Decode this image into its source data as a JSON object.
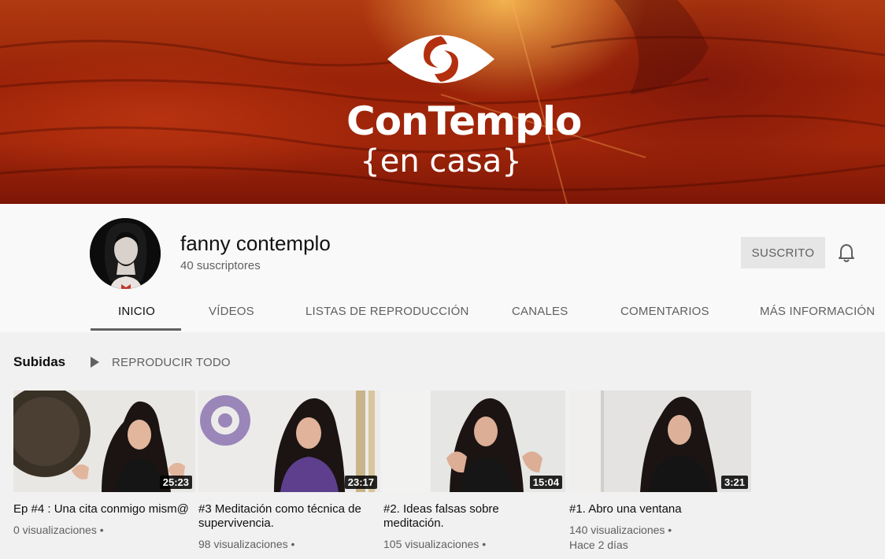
{
  "banner": {
    "brand": "ConTemplo",
    "tagline": "{en casa}",
    "icon": "eye-swirl-logo"
  },
  "channel": {
    "name": "fanny contemplo",
    "subscribers": "40 suscriptores",
    "subscribe_label": "SUSCRITO",
    "bell_icon": "bell-icon"
  },
  "tabs": [
    {
      "label": "INICIO"
    },
    {
      "label": "VÍDEOS"
    },
    {
      "label": "LISTAS DE REPRODUCCIÓN"
    },
    {
      "label": "CANALES"
    },
    {
      "label": "COMENTARIOS"
    },
    {
      "label": "MÁS INFORMACIÓN"
    }
  ],
  "active_tab": "INICIO",
  "section": {
    "title": "Subidas",
    "play_all": "REPRODUCIR TODO",
    "play_icon": "play-icon"
  },
  "videos": [
    {
      "title": "Ep #4 : Una cita conmigo mism@",
      "duration": "25:23",
      "views": "0 visualizaciones",
      "age": ""
    },
    {
      "title": "#3 Meditación como técnica de supervivencia.",
      "duration": "23:17",
      "views": "98 visualizaciones",
      "age": ""
    },
    {
      "title": "#2. Ideas falsas sobre meditación.",
      "duration": "15:04",
      "views": "105 visualizaciones",
      "age": ""
    },
    {
      "title": "#1. Abro una ventana",
      "duration": "3:21",
      "views": "140 visualizaciones",
      "age": "Hace 2 días"
    }
  ],
  "colors": {
    "banner": "#9a2208",
    "accent_gray": "#606060",
    "button_bg": "#e6e6e6"
  }
}
